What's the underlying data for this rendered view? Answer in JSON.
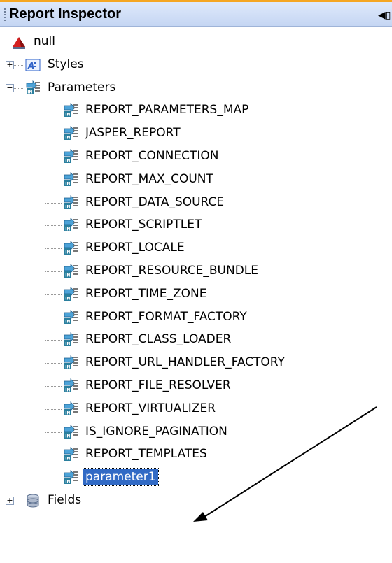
{
  "panel": {
    "title": "Report Inspector",
    "button_glyph": "◀▯"
  },
  "tree": {
    "root": {
      "label": "null",
      "icon": "report-icon"
    },
    "styles": {
      "label": "Styles",
      "icon": "styles-icon",
      "expanded": false
    },
    "parameters": {
      "label": "Parameters",
      "icon": "parameter-icon",
      "expanded": true,
      "items": [
        "REPORT_PARAMETERS_MAP",
        "JASPER_REPORT",
        "REPORT_CONNECTION",
        "REPORT_MAX_COUNT",
        "REPORT_DATA_SOURCE",
        "REPORT_SCRIPTLET",
        "REPORT_LOCALE",
        "REPORT_RESOURCE_BUNDLE",
        "REPORT_TIME_ZONE",
        "REPORT_FORMAT_FACTORY",
        "REPORT_CLASS_LOADER",
        "REPORT_URL_HANDLER_FACTORY",
        "REPORT_FILE_RESOLVER",
        "REPORT_VIRTUALIZER",
        "IS_IGNORE_PAGINATION",
        "REPORT_TEMPLATES",
        "parameter1"
      ],
      "selected": "parameter1"
    },
    "fields": {
      "label": "Fields",
      "icon": "database-icon",
      "expanded": false
    }
  },
  "annotation": {
    "type": "arrow",
    "points_to": "parameter1"
  },
  "colors": {
    "title_accent": "#f5a623",
    "selection": "#316ac5",
    "arrow": "#000000"
  }
}
